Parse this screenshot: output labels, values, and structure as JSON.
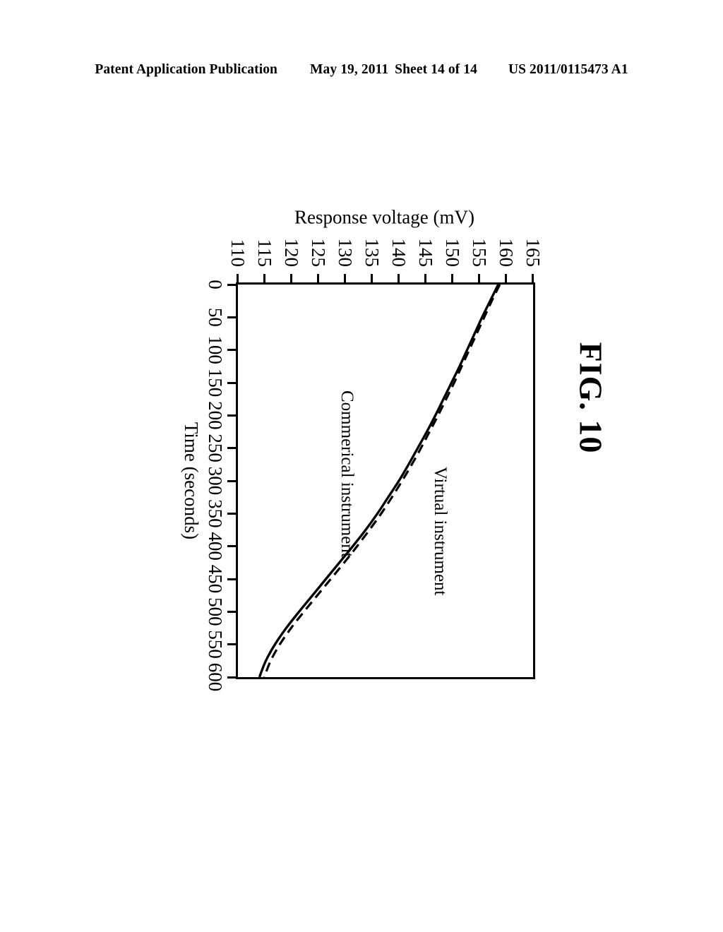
{
  "header": {
    "publication": "Patent Application Publication",
    "date": "May 19, 2011",
    "sheet": "Sheet 14 of 14",
    "doc_number": "US 2011/0115473 A1"
  },
  "figure": {
    "caption": "FIG. 10"
  },
  "chart_data": {
    "type": "line",
    "title": "",
    "xlabel": "Time (seconds)",
    "ylabel": "Response voltage (mV)",
    "xlim": [
      0,
      600
    ],
    "ylim": [
      110,
      165
    ],
    "xticks": [
      0,
      50,
      100,
      150,
      200,
      250,
      300,
      350,
      400,
      450,
      500,
      550,
      600
    ],
    "xtick_labels": [
      "0",
      "50",
      "100",
      "150",
      "200",
      "250",
      "300",
      "350",
      "400",
      "450",
      "500",
      "550",
      "600"
    ],
    "yticks": [
      110,
      115,
      120,
      125,
      130,
      135,
      140,
      145,
      150,
      155,
      160,
      165
    ],
    "ytick_labels": [
      "110",
      "115",
      "120",
      "125",
      "130",
      "135",
      "140",
      "145",
      "150",
      "155",
      "160",
      "165"
    ],
    "grid": false,
    "legend_position": "inline-annotations",
    "rotation_on_page_degrees": 90,
    "x": [
      0,
      25,
      50,
      75,
      100,
      125,
      150,
      175,
      200,
      225,
      250,
      275,
      300,
      325,
      350,
      375,
      400,
      425,
      450,
      475,
      500,
      525,
      550,
      575,
      600
    ],
    "series": [
      {
        "name": "Virtual instrument",
        "style": "dashed",
        "color": "#000000",
        "values": [
          158.8,
          157.3,
          155.9,
          154.5,
          153.1,
          151.7,
          150.3,
          148.8,
          147.3,
          145.7,
          144.1,
          142.4,
          140.6,
          138.7,
          136.7,
          134.5,
          132.2,
          129.8,
          127.3,
          124.8,
          122.3,
          119.9,
          117.8,
          116.1,
          114.9
        ]
      },
      {
        "name": "Commerical instrument",
        "style": "solid",
        "color": "#000000",
        "values": [
          158.5,
          157.0,
          155.5,
          154.1,
          152.7,
          151.3,
          149.8,
          148.3,
          146.8,
          145.2,
          143.5,
          141.8,
          140.0,
          138.0,
          136.0,
          133.8,
          131.4,
          128.9,
          126.4,
          123.9,
          121.4,
          119.0,
          116.9,
          115.2,
          114.0
        ]
      }
    ],
    "annotations": [
      {
        "text": "Virtual instrument",
        "refers_to": "Virtual instrument"
      },
      {
        "text": "Commerical instrument",
        "refers_to": "Commerical instrument"
      }
    ]
  }
}
